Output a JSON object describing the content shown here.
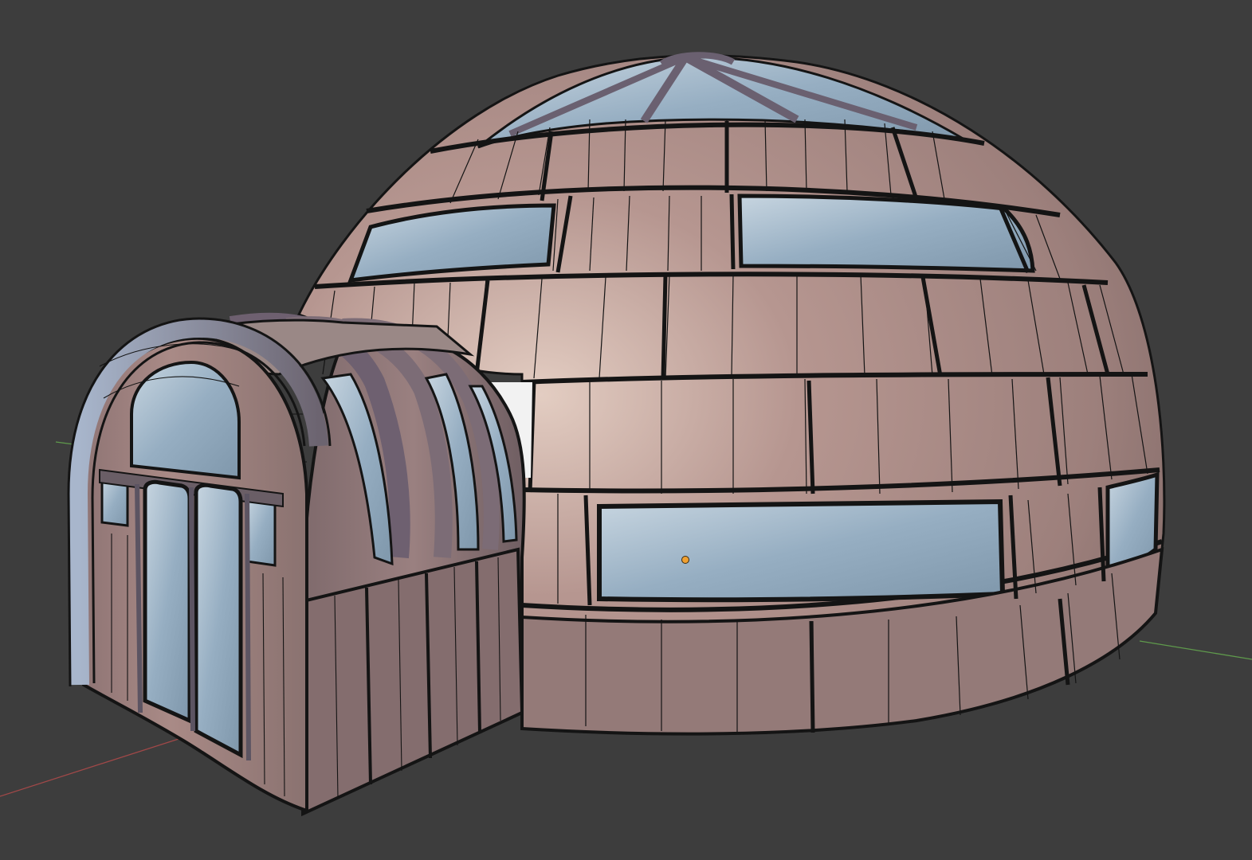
{
  "viewport": {
    "background_color": "#3d3d3d",
    "shading": "solid",
    "overlay": "wireframe",
    "axis_x_color": "#a04848",
    "axis_y_color": "#5f9a4c"
  },
  "scene": {
    "object": "igloo-with-entrance-tunnel",
    "selected": true,
    "origin_color": "#f0a030",
    "materials": {
      "panel": "#ad8e88",
      "panel_highlight": "#e6d0c4",
      "panel_shadow": "#6f5a58",
      "glass": "#92aabe",
      "glass_highlight": "#d5e2ec",
      "frame": "#8d7e82",
      "frame_gloss": "#b4c2d8",
      "wire": "#141414"
    }
  }
}
